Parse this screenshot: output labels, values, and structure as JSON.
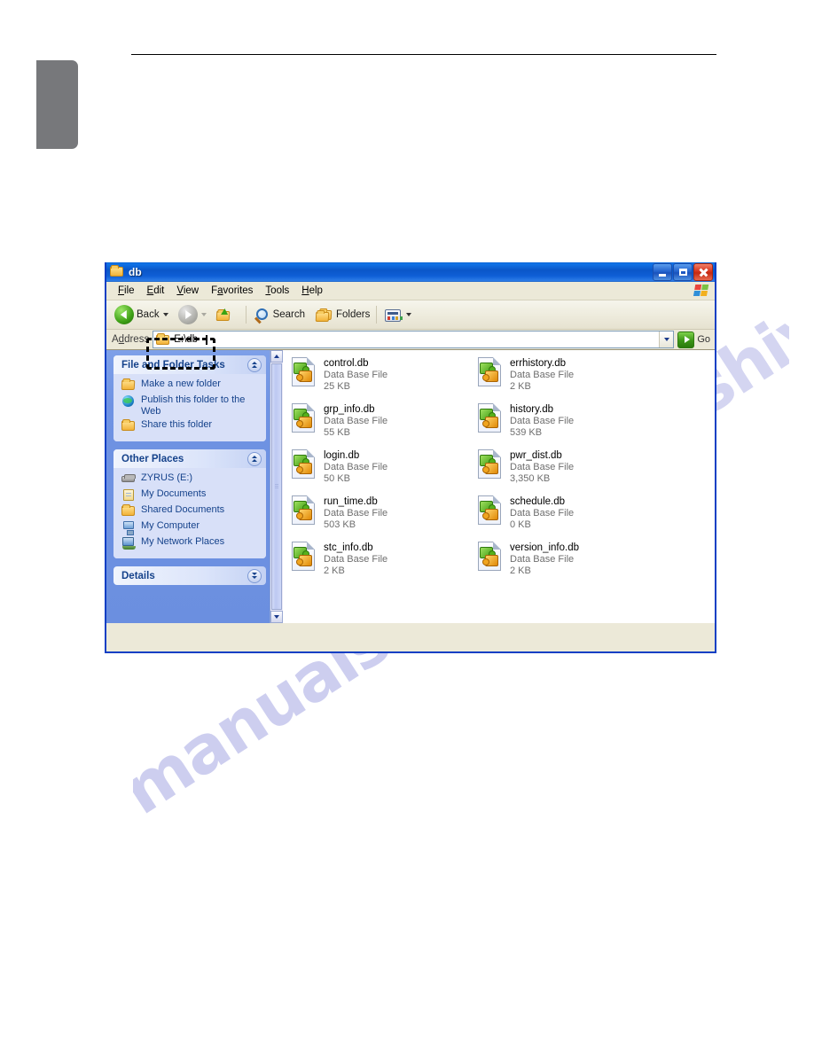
{
  "watermark": {
    "text": "manualshive.com"
  },
  "window": {
    "title": "db",
    "title_icon": "folder-icon",
    "buttons": {
      "minimize": "Minimize",
      "maximize": "Maximize",
      "close": "Close"
    }
  },
  "menubar": {
    "items": [
      {
        "label": "File",
        "accel": "F"
      },
      {
        "label": "Edit",
        "accel": "E"
      },
      {
        "label": "View",
        "accel": "V"
      },
      {
        "label": "Favorites",
        "accel": "a"
      },
      {
        "label": "Tools",
        "accel": "T"
      },
      {
        "label": "Help",
        "accel": "H"
      }
    ],
    "brand_icon": "windows-flag-icon"
  },
  "toolbar": {
    "back_label": "Back",
    "back_icon": "back-arrow-icon",
    "forward_icon": "forward-arrow-icon",
    "up_icon": "up-folder-icon",
    "search_label": "Search",
    "search_icon": "magnifier-icon",
    "folders_label": "Folders",
    "folders_icon": "folders-icon",
    "views_icon": "views-icon"
  },
  "address": {
    "label": "Address",
    "accel": "d",
    "value": "E:\\db",
    "icon": "folder-icon",
    "dropdown_icon": "chevron-down-icon",
    "go_label": "Go",
    "go_icon": "go-arrow-icon",
    "highlighted": true
  },
  "sidebar": {
    "scrollbar": {
      "up_icon": "scroll-up-icon",
      "down_icon": "scroll-down-icon"
    },
    "panels": [
      {
        "title": "File and Folder Tasks",
        "collapsed": false,
        "toggle_icon": "chevron-up-icon",
        "items": [
          {
            "label": "Make a new folder",
            "icon": "new-folder-icon"
          },
          {
            "label": "Publish this folder to the Web",
            "icon": "globe-icon"
          },
          {
            "label": "Share this folder",
            "icon": "share-folder-icon"
          }
        ]
      },
      {
        "title": "Other Places",
        "collapsed": false,
        "toggle_icon": "chevron-up-icon",
        "items": [
          {
            "label": "ZYRUS (E:)",
            "icon": "drive-icon"
          },
          {
            "label": "My Documents",
            "icon": "my-documents-icon"
          },
          {
            "label": "Shared Documents",
            "icon": "shared-documents-icon"
          },
          {
            "label": "My Computer",
            "icon": "my-computer-icon"
          },
          {
            "label": "My Network Places",
            "icon": "my-network-places-icon"
          }
        ]
      },
      {
        "title": "Details",
        "collapsed": true,
        "toggle_icon": "chevron-down-icon",
        "items": []
      }
    ]
  },
  "files": {
    "icon": "database-file-icon",
    "column_left": [
      {
        "name": "control.db",
        "type": "Data Base File",
        "size": "25 KB"
      },
      {
        "name": "grp_info.db",
        "type": "Data Base File",
        "size": "55 KB"
      },
      {
        "name": "login.db",
        "type": "Data Base File",
        "size": "50 KB"
      },
      {
        "name": "run_time.db",
        "type": "Data Base File",
        "size": "503 KB"
      },
      {
        "name": "stc_info.db",
        "type": "Data Base File",
        "size": "2 KB"
      }
    ],
    "column_right": [
      {
        "name": "errhistory.db",
        "type": "Data Base File",
        "size": "2 KB"
      },
      {
        "name": "history.db",
        "type": "Data Base File",
        "size": "539 KB"
      },
      {
        "name": "pwr_dist.db",
        "type": "Data Base File",
        "size": "3,350 KB"
      },
      {
        "name": "schedule.db",
        "type": "Data Base File",
        "size": "0 KB"
      },
      {
        "name": "version_info.db",
        "type": "Data Base File",
        "size": "2 KB"
      }
    ]
  },
  "colors": {
    "title_blue": "#0b56c8",
    "window_border": "#0b3fc4",
    "chrome_beige": "#ece9d8",
    "sidebar_blue": "#6f93e3",
    "panel_body": "#d8e0f8",
    "link_blue": "#15428b",
    "watermark": "#babcea"
  }
}
